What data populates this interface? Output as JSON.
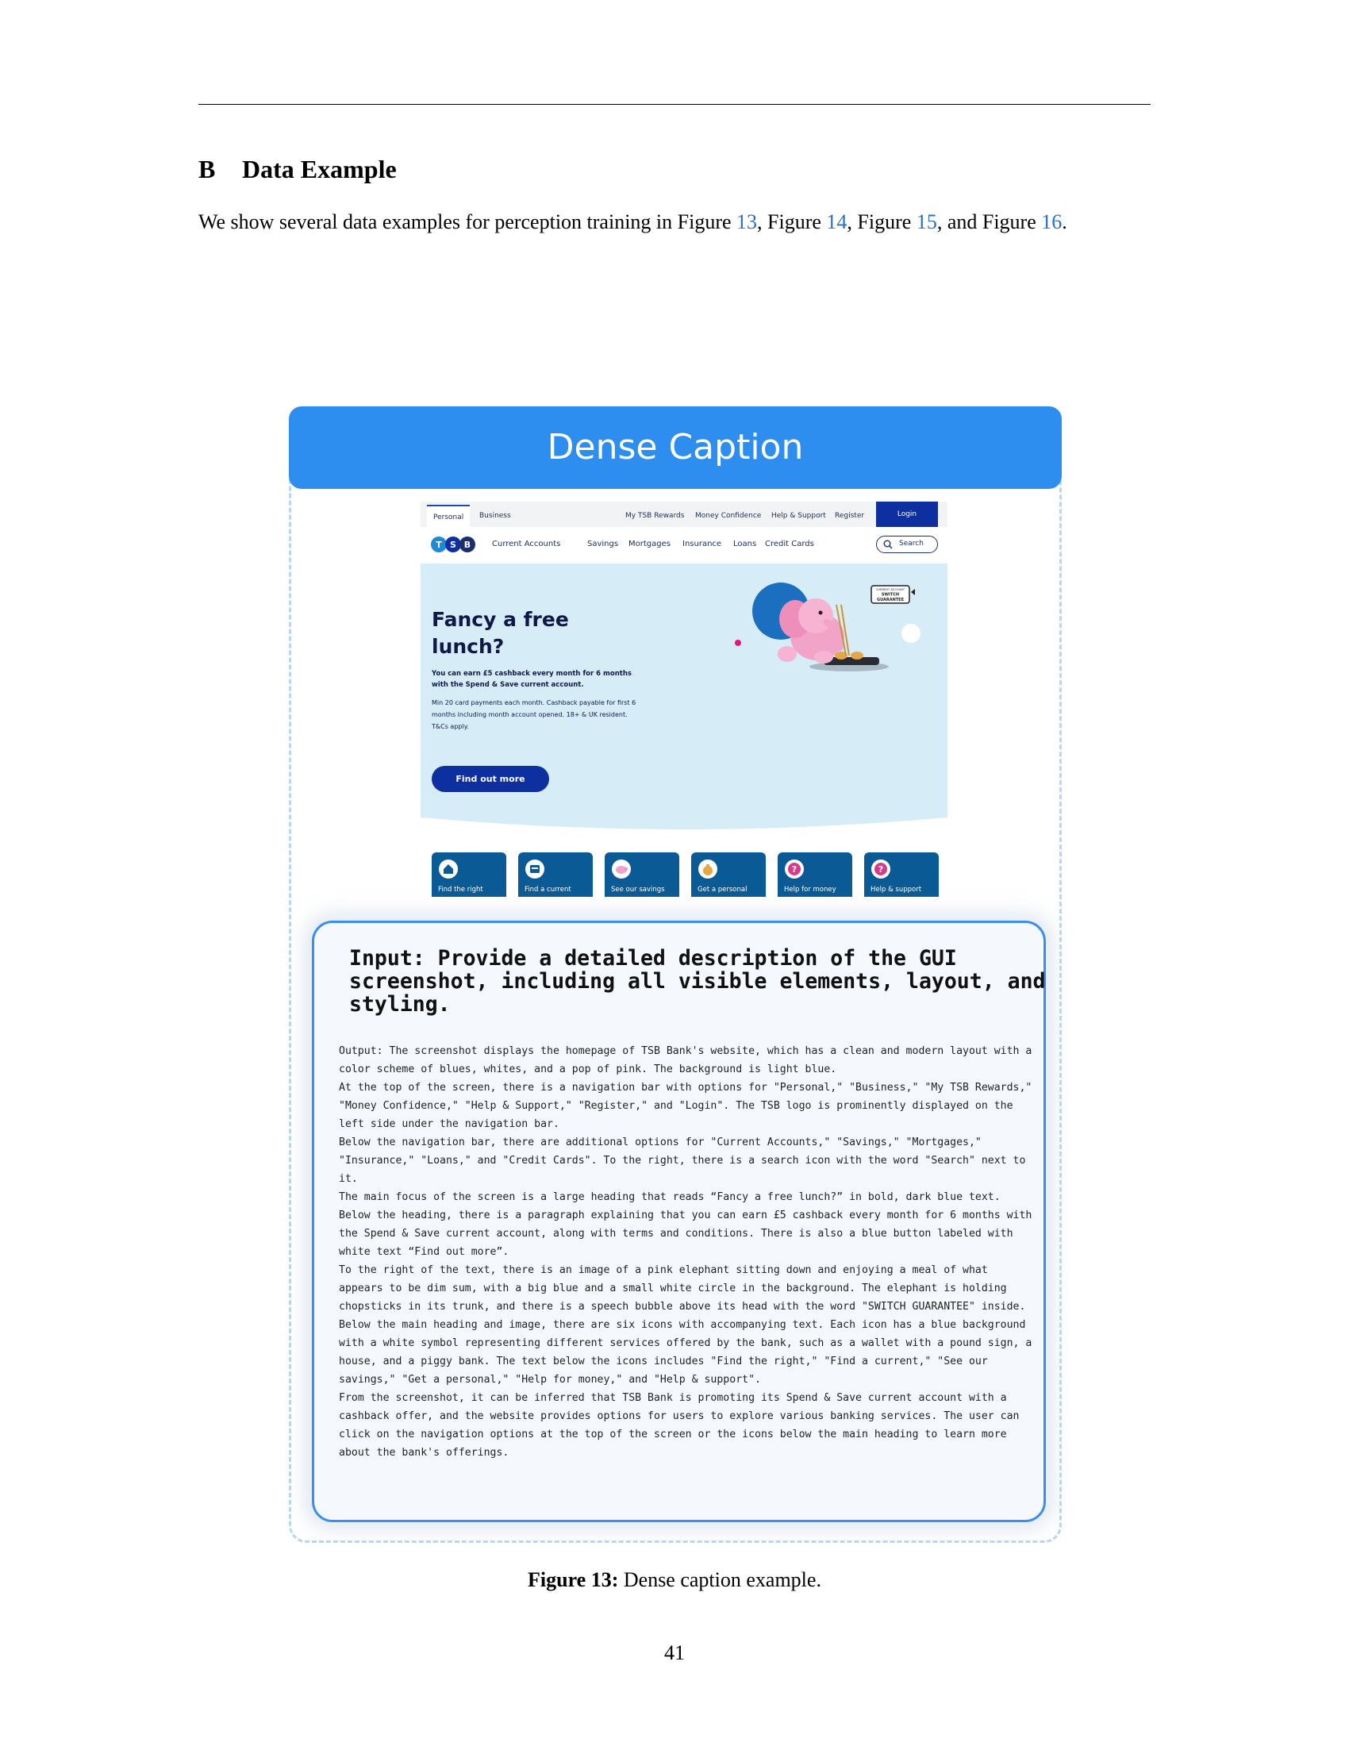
{
  "section": {
    "number": "B",
    "title": "Data Example"
  },
  "intro": {
    "text_before": "We show several data examples for perception training in ",
    "refs": [
      {
        "prefix": "Figure ",
        "num": "13",
        "suffix": ", "
      },
      {
        "prefix": "Figure ",
        "num": "14",
        "suffix": ", "
      },
      {
        "prefix": "Figure ",
        "num": "15",
        "suffix": ", and "
      },
      {
        "prefix": "Figure ",
        "num": "16",
        "suffix": "."
      }
    ]
  },
  "figure": {
    "header_title": "Dense Caption",
    "caption_label": "Figure 13:",
    "caption_text": " Dense caption example."
  },
  "screenshot": {
    "tabs": [
      "Personal",
      "Business"
    ],
    "utility_links": [
      "My TSB Rewards",
      "Money Confidence",
      "Help & Support",
      "Register"
    ],
    "login_label": "Login",
    "main_links": [
      "Current Accounts",
      "Savings",
      "Mortgages",
      "Insurance",
      "Loans",
      "Credit Cards"
    ],
    "search_label": "Search",
    "hero": {
      "title": "Fancy a free lunch?",
      "lead": "You can earn £5 cashback every month for 6 months with the Spend & Save current account.",
      "body": "Min 20 card payments each month. Cashback payable for first 6 months including month account opened. 18+ & UK resident. T&Cs apply.",
      "button": "Find out more",
      "badge_line1": "CURRENT ACCOUNT",
      "badge_line2": "SWITCH",
      "badge_line3": "GUARANTEE"
    },
    "tiles": [
      {
        "label": "Find the right",
        "icon": "house-icon"
      },
      {
        "label": "Find a current",
        "icon": "card-icon"
      },
      {
        "label": "See our savings",
        "icon": "piggy-bank-icon"
      },
      {
        "label": "Get a personal",
        "icon": "money-bag-icon"
      },
      {
        "label": "Help for money",
        "icon": "question-icon"
      },
      {
        "label": "Help & support",
        "icon": "question-icon"
      }
    ],
    "colors": {
      "brand_blue": "#0d2fa0",
      "hero_bg": "#d6ecf6",
      "tile_bg": "#0a5a96",
      "elephant_pink": "#f2a3c8"
    }
  },
  "qa": {
    "input": "Input: Provide a detailed description of the GUI\nscreenshot, including all visible elements, layout, and\nstyling.",
    "output_paragraphs": [
      "Output: The screenshot displays the homepage of TSB Bank's website, which has a clean and modern layout with a color scheme of blues, whites, and a pop of pink. The background is light blue.",
      "At the top of the screen, there is a navigation bar with options for \"Personal,\" \"Business,\" \"My TSB Rewards,\" \"Money Confidence,\" \"Help & Support,\" \"Register,\" and \"Login\". The TSB logo is prominently displayed on the left side under the navigation bar.",
      "Below the navigation bar, there are additional options for \"Current Accounts,\" \"Savings,\" \"Mortgages,\" \"Insurance,\" \"Loans,\" and \"Credit Cards\". To the right, there is a search icon with the word \"Search\" next to it.",
      "The main focus of the screen is a large heading that reads “Fancy a free lunch?” in bold, dark blue text. Below the heading, there is a paragraph explaining that you can earn £5 cashback every month for 6 months with the Spend & Save current account, along with terms and conditions. There is also a blue button labeled with white text “Find out more”.",
      "To the right of the text, there is an image of a pink elephant sitting down and enjoying a meal of what appears to be dim sum, with a big blue and a small white circle in the background. The elephant is holding chopsticks in its trunk, and there is a speech bubble above its head with the word \"SWITCH GUARANTEE\" inside.",
      "Below the main heading and image, there are six icons with accompanying text. Each icon has a blue background with a white symbol representing different services offered by the bank, such as a wallet with a pound sign, a house, and a piggy bank. The text below the icons includes \"Find the right,\" \"Find a current,\" \"See our savings,\" \"Get a personal,\" \"Help for money,\" and \"Help & support\".",
      "From the screenshot, it can be inferred that TSB Bank is promoting its Spend & Save current account with a cashback offer, and the website provides options for users to explore various banking services. The user can click on the navigation options at the top of the screen or the icons below the main heading to learn more about the bank's offerings."
    ]
  },
  "page_number": "41"
}
